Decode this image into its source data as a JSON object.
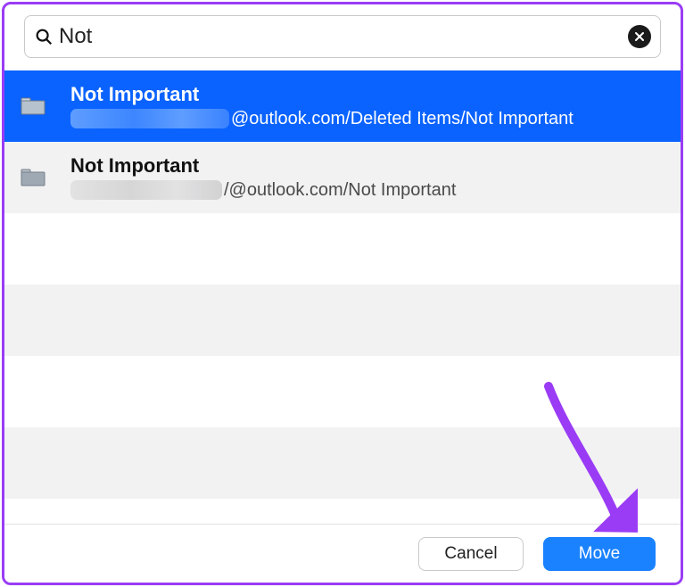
{
  "search": {
    "value": "Not",
    "placeholder": ""
  },
  "results": [
    {
      "title": "Not Important",
      "path_suffix": "@outlook.com/Deleted Items/Not Important",
      "selected": true
    },
    {
      "title": "Not Important",
      "path_suffix": "/@outlook.com/Not Important",
      "selected": false
    }
  ],
  "footer": {
    "cancel_label": "Cancel",
    "move_label": "Move"
  },
  "colors": {
    "selection": "#0a63ff",
    "primary_button": "#1a82ff",
    "annotation_arrow": "#9a3cf5"
  }
}
